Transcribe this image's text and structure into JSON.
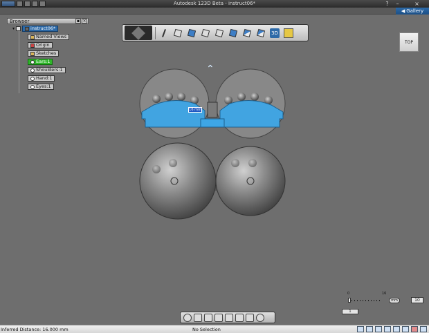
{
  "app": {
    "title": "Autodesk 123D Beta - instruct06*"
  },
  "gallery": {
    "label": "Gallery",
    "arrow": "◀"
  },
  "window_controls": {
    "help": "?",
    "minimize": "–",
    "close": "×"
  },
  "browser": {
    "title": "Browser",
    "header_buttons": [
      "▪",
      "×"
    ],
    "nodes": [
      {
        "label": "instruct06*",
        "kind": "root"
      },
      {
        "label": "Named Views",
        "kind": "folder"
      },
      {
        "label": "Origin",
        "kind": "folder"
      },
      {
        "label": "Sketches",
        "kind": "folder"
      },
      {
        "label": "Ears:1",
        "kind": "active"
      },
      {
        "label": "Shoulders:1",
        "kind": "body"
      },
      {
        "label": "Hand:1",
        "kind": "body"
      },
      {
        "label": "Eyes:1",
        "kind": "body"
      }
    ]
  },
  "toolbar": {
    "buttons": [
      "pencil-icon",
      "box-icon",
      "move-icon",
      "transform-icon",
      "rotate-icon",
      "surface-icon",
      "pattern-icon",
      "construct-icon",
      "3d-icon",
      "star-icon"
    ],
    "label_3d": "3D"
  },
  "viewcube": {
    "face": "TOP"
  },
  "viewport": {
    "measure_label": "16 mm",
    "manipulator": "⌃"
  },
  "nav_toolbar": {
    "buttons": [
      "orbit-icon",
      "pan-icon",
      "zoom-icon",
      "fit-icon",
      "view-icon",
      "display-icon",
      "material-icon",
      "measure-icon"
    ]
  },
  "snap": {
    "min_label": "0",
    "max_label": "16",
    "unit": "mm",
    "value": "10",
    "grid_value": "1"
  },
  "status": {
    "left": "Inferred Distance: 16.000 mm",
    "center": "No Selection"
  },
  "colors": {
    "background": "#6e6e6e",
    "selection_blue": "#3ea6e6",
    "active_green": "#2fb52a",
    "accent_blue": "#2d6aa8"
  }
}
